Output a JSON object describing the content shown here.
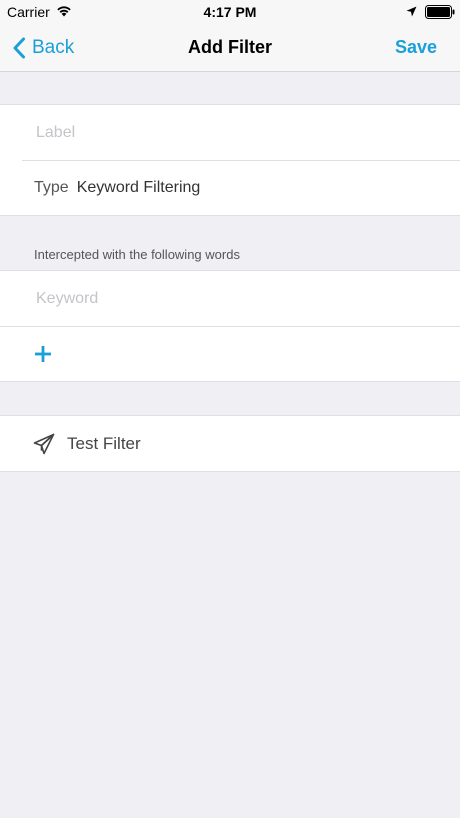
{
  "status_bar": {
    "carrier": "Carrier",
    "time": "4:17 PM"
  },
  "nav": {
    "back_label": "Back",
    "title": "Add Filter",
    "save_label": "Save"
  },
  "form": {
    "label_placeholder": "Label",
    "type_key": "Type",
    "type_value": "Keyword Filtering"
  },
  "words_section": {
    "header": "Intercepted with the following words",
    "keyword_placeholder": "Keyword",
    "add_icon": "plus-icon"
  },
  "actions": {
    "test_filter_label": "Test Filter",
    "test_icon": "paper-plane-icon"
  },
  "colors": {
    "accent": "#1aa0d8",
    "background": "#efeff4"
  }
}
